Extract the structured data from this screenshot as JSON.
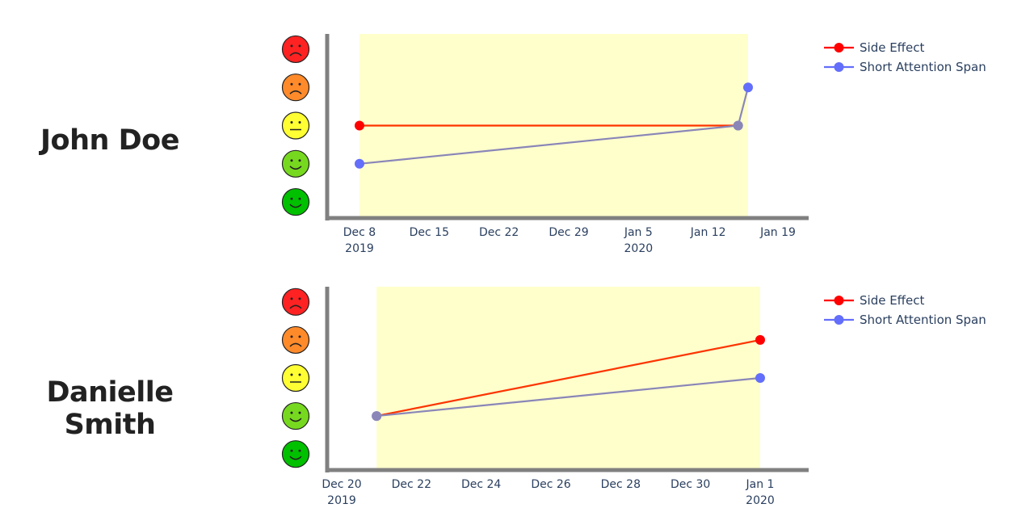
{
  "patients": [
    {
      "name": "John Doe",
      "chart_data": {
        "type": "line",
        "title": "",
        "xlabel": "",
        "ylabel": "",
        "y_scale": [
          "very good",
          "good",
          "neutral",
          "bad",
          "very bad"
        ],
        "y_icons": [
          "green-smile-icon",
          "lightgreen-smile-icon",
          "yellow-neutral-icon",
          "orange-frown-icon",
          "red-frown-icon"
        ],
        "ylim": [
          0.6,
          5.4
        ],
        "xlim": [
          "2019-12-04",
          "2020-01-19"
        ],
        "x_ticks": [
          {
            "date": "2019-12-08",
            "label": "Dec 8",
            "sub": "2019"
          },
          {
            "date": "2019-12-15",
            "label": "Dec 15",
            "sub": ""
          },
          {
            "date": "2019-12-22",
            "label": "Dec 22",
            "sub": ""
          },
          {
            "date": "2019-12-29",
            "label": "Dec 29",
            "sub": ""
          },
          {
            "date": "2020-01-05",
            "label": "Jan 5",
            "sub": "2020"
          },
          {
            "date": "2020-01-12",
            "label": "Jan 12",
            "sub": ""
          },
          {
            "date": "2020-01-19",
            "label": "Jan 19",
            "sub": ""
          }
        ],
        "shaded_range": [
          "2019-12-08",
          "2020-01-16"
        ],
        "series": [
          {
            "name": "Side Effect",
            "color": "#ff0000",
            "x": [
              "2019-12-08",
              "2020-01-15"
            ],
            "y": [
              3,
              3
            ]
          },
          {
            "name": "Short Attention Span",
            "color": "#636efa",
            "x": [
              "2019-12-08",
              "2020-01-15",
              "2020-01-16"
            ],
            "y": [
              2,
              3,
              4
            ]
          }
        ],
        "legend": "top-right",
        "grid": false
      }
    },
    {
      "name": "Danielle Smith",
      "chart_data": {
        "type": "line",
        "title": "",
        "xlabel": "",
        "ylabel": "",
        "y_scale": [
          "very good",
          "good",
          "neutral",
          "bad",
          "very bad"
        ],
        "y_icons": [
          "green-smile-icon",
          "lightgreen-smile-icon",
          "yellow-neutral-icon",
          "orange-frown-icon",
          "red-frown-icon"
        ],
        "ylim": [
          0.6,
          5.4
        ],
        "xlim": [
          "2019-12-20",
          "2020-01-02"
        ],
        "x_ticks": [
          {
            "date": "2019-12-20",
            "label": "Dec 20",
            "sub": "2019"
          },
          {
            "date": "2019-12-22",
            "label": "Dec 22",
            "sub": ""
          },
          {
            "date": "2019-12-24",
            "label": "Dec 24",
            "sub": ""
          },
          {
            "date": "2019-12-26",
            "label": "Dec 26",
            "sub": ""
          },
          {
            "date": "2019-12-28",
            "label": "Dec 28",
            "sub": ""
          },
          {
            "date": "2019-12-30",
            "label": "Dec 30",
            "sub": ""
          },
          {
            "date": "2020-01-01",
            "label": "Jan 1",
            "sub": "2020"
          }
        ],
        "shaded_range": [
          "2019-12-21",
          "2020-01-01"
        ],
        "series": [
          {
            "name": "Side Effect",
            "color": "#ff0000",
            "x": [
              "2019-12-21",
              "2020-01-01"
            ],
            "y": [
              2,
              4
            ]
          },
          {
            "name": "Short Attention Span",
            "color": "#636efa",
            "x": [
              "2019-12-21",
              "2020-01-01"
            ],
            "y": [
              2,
              3
            ]
          }
        ],
        "legend": "top-right",
        "grid": false
      }
    }
  ]
}
